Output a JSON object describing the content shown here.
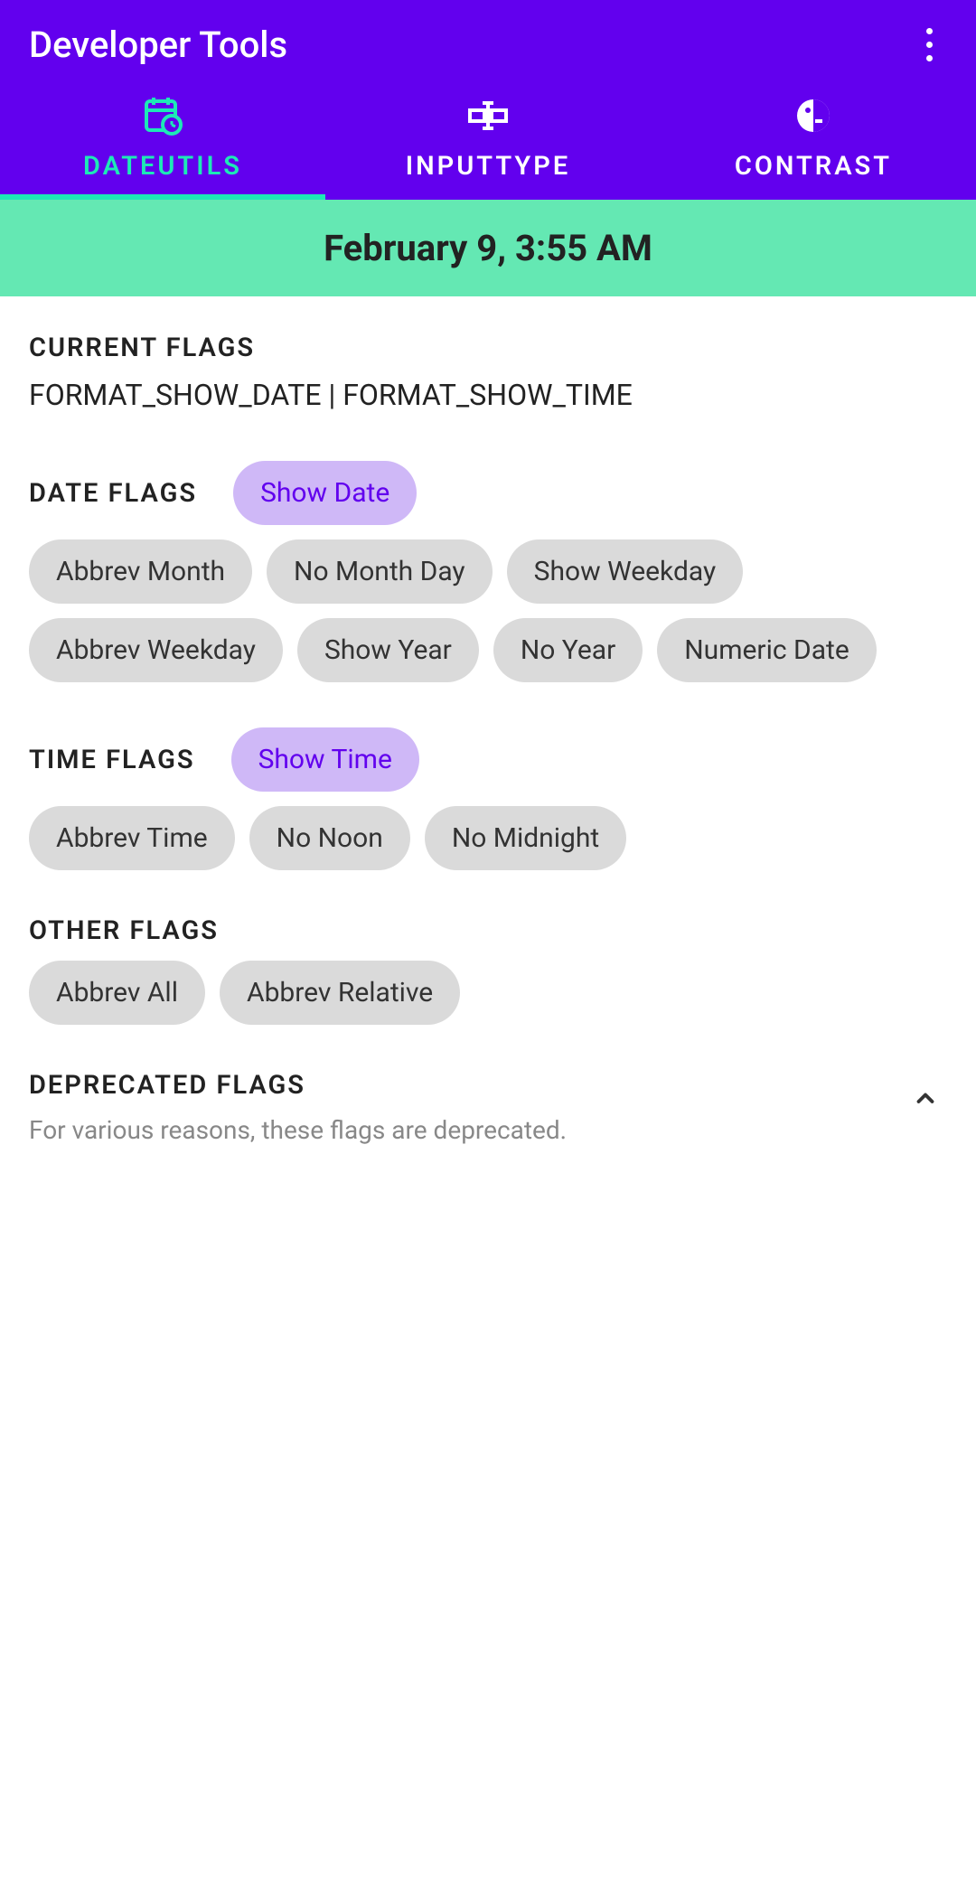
{
  "header": {
    "title": "Developer Tools"
  },
  "tabs": [
    {
      "label": "DATEUTILS",
      "active": true
    },
    {
      "label": "INPUTTYPE",
      "active": false
    },
    {
      "label": "CONTRAST",
      "active": false
    }
  ],
  "date_display": "February 9, 3:55 AM",
  "current_flags": {
    "header": "CURRENT FLAGS",
    "value": "FORMAT_SHOW_DATE | FORMAT_SHOW_TIME"
  },
  "date_flags": {
    "header": "DATE FLAGS",
    "primary_chip": "Show Date",
    "chips": [
      "Abbrev Month",
      "No Month Day",
      "Show Weekday",
      "Abbrev Weekday",
      "Show Year",
      "No Year",
      "Numeric Date"
    ]
  },
  "time_flags": {
    "header": "TIME FLAGS",
    "primary_chip": "Show Time",
    "chips": [
      "Abbrev Time",
      "No Noon",
      "No Midnight"
    ]
  },
  "other_flags": {
    "header": "OTHER FLAGS",
    "chips": [
      "Abbrev All",
      "Abbrev Relative"
    ]
  },
  "deprecated": {
    "header": "DEPRECATED FLAGS",
    "subtitle": "For various reasons, these flags are deprecated."
  }
}
